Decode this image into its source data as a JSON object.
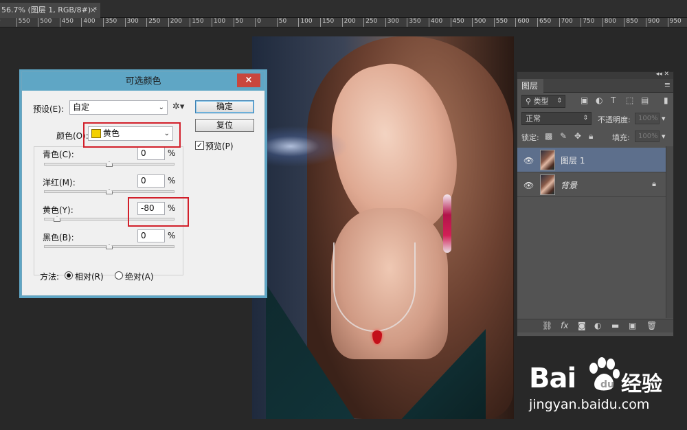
{
  "document_tab": {
    "title": "56.7% (图层 1, RGB/8#) *",
    "close": "×"
  },
  "ruler": {
    "ticks": [
      "0",
      "550",
      "500",
      "450",
      "400",
      "350",
      "300",
      "250",
      "200",
      "150",
      "100",
      "50",
      "0",
      "50",
      "100",
      "150",
      "200",
      "250",
      "300",
      "350",
      "400",
      "450",
      "500",
      "550",
      "600",
      "650",
      "700",
      "750",
      "800",
      "850",
      "900",
      "950"
    ]
  },
  "dialog": {
    "title": "可选颜色",
    "close": "×",
    "preset_label": "预设(E):",
    "preset_value": "自定",
    "ok_label": "确定",
    "reset_label": "复位",
    "preview_label": "预览(P)",
    "preview_checked": true,
    "colors_label": "颜色(O):",
    "colors_value": "黄色",
    "swatch_color": "#f3d000",
    "sliders": [
      {
        "label": "青色(C):",
        "value": "0",
        "unit": "%"
      },
      {
        "label": "洋红(M):",
        "value": "0",
        "unit": "%"
      },
      {
        "label": "黄色(Y):",
        "value": "-80",
        "unit": "%"
      },
      {
        "label": "黑色(B):",
        "value": "0",
        "unit": "%"
      }
    ],
    "method_label": "方法:",
    "method_relative": "相对(R)",
    "method_absolute": "绝对(A)",
    "method_selected": "relative"
  },
  "layers_panel": {
    "tab_label": "图层",
    "filter_label": "类型",
    "blend_mode": "正常",
    "opacity_label": "不透明度:",
    "opacity_value": "100%",
    "lock_label": "锁定:",
    "fill_label": "填充:",
    "fill_value": "100%",
    "layers": [
      {
        "name": "图层 1",
        "selected": true,
        "locked": false
      },
      {
        "name": "背景",
        "selected": false,
        "locked": true
      }
    ]
  },
  "watermark": {
    "logo": "Bai",
    "logo_cn": "经验",
    "url": "jingyan.baidu.com"
  },
  "colors": {
    "highlight_red": "#d21f2a",
    "dialog_title_bar": "#5fa6c5",
    "selected_layer": "#5d6f8c"
  }
}
